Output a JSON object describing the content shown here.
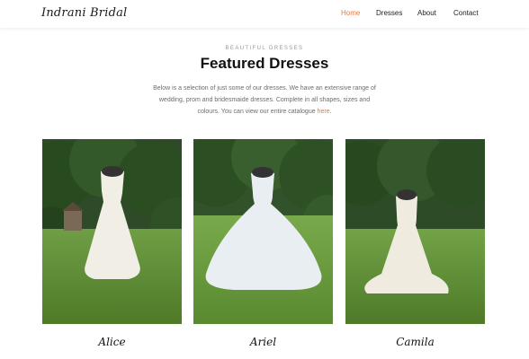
{
  "nav": {
    "brand": "Indrani Bridal",
    "links": [
      "Home",
      "Dresses",
      "About",
      "Contact"
    ],
    "active_color": "#e8793a"
  },
  "hero": {
    "kicker": "BEAUTIFUL DRESSES",
    "title": "Featured Dresses",
    "intro_text": "Below is a selection of just some of our dresses. We have an extensive range of wedding, prom and bridesmaide dresses. Complete in all shapes, sizes and colours. You can view our entire catalogue",
    "intro_link": "here",
    "intro_end": "."
  },
  "dresses": [
    {
      "name": "Alice"
    },
    {
      "name": "Ariel"
    },
    {
      "name": "Camila"
    }
  ]
}
